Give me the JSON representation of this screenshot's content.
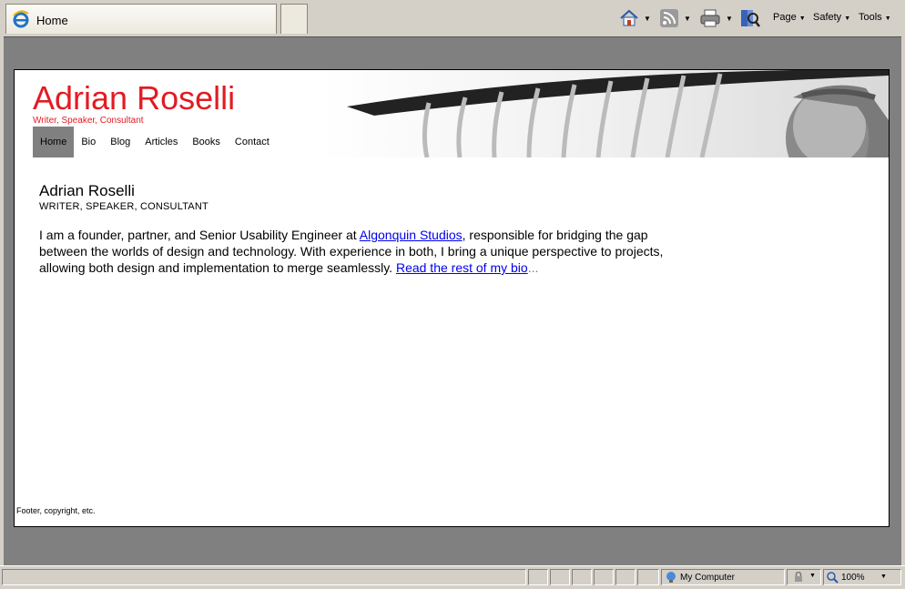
{
  "browser": {
    "tab_title": "Home",
    "menus": {
      "page": "Page",
      "safety": "Safety",
      "tools": "Tools"
    },
    "status": {
      "zone": "My Computer",
      "zoom": "100%"
    },
    "icons": [
      "ie-logo-icon",
      "home-icon",
      "feeds-icon",
      "print-icon",
      "research-icon",
      "computer-icon",
      "lock-icon",
      "zoom-icon"
    ]
  },
  "site": {
    "title": "Adrian Roselli",
    "tagline": "Writer, Speaker, Consultant",
    "nav": [
      "Home",
      "Bio",
      "Blog",
      "Articles",
      "Books",
      "Contact"
    ],
    "accent_color": "#e21b23"
  },
  "content": {
    "heading": "Adrian Roselli",
    "subheading": "WRITER, SPEAKER, CONSULTANT",
    "bio_before": "I am a founder, partner, and Senior Usability Engineer at ",
    "bio_link": "Algonquin Studios",
    "bio_after": ", responsible for bridging the gap between the worlds of design and technology. With experience in both, I bring a unique perspective to projects, allowing both design and implementation to merge seamlessly. ",
    "read_more": "Read the rest of my bio",
    "ellipsis": "..."
  },
  "footer": {
    "text": "Footer, copyright, etc."
  }
}
